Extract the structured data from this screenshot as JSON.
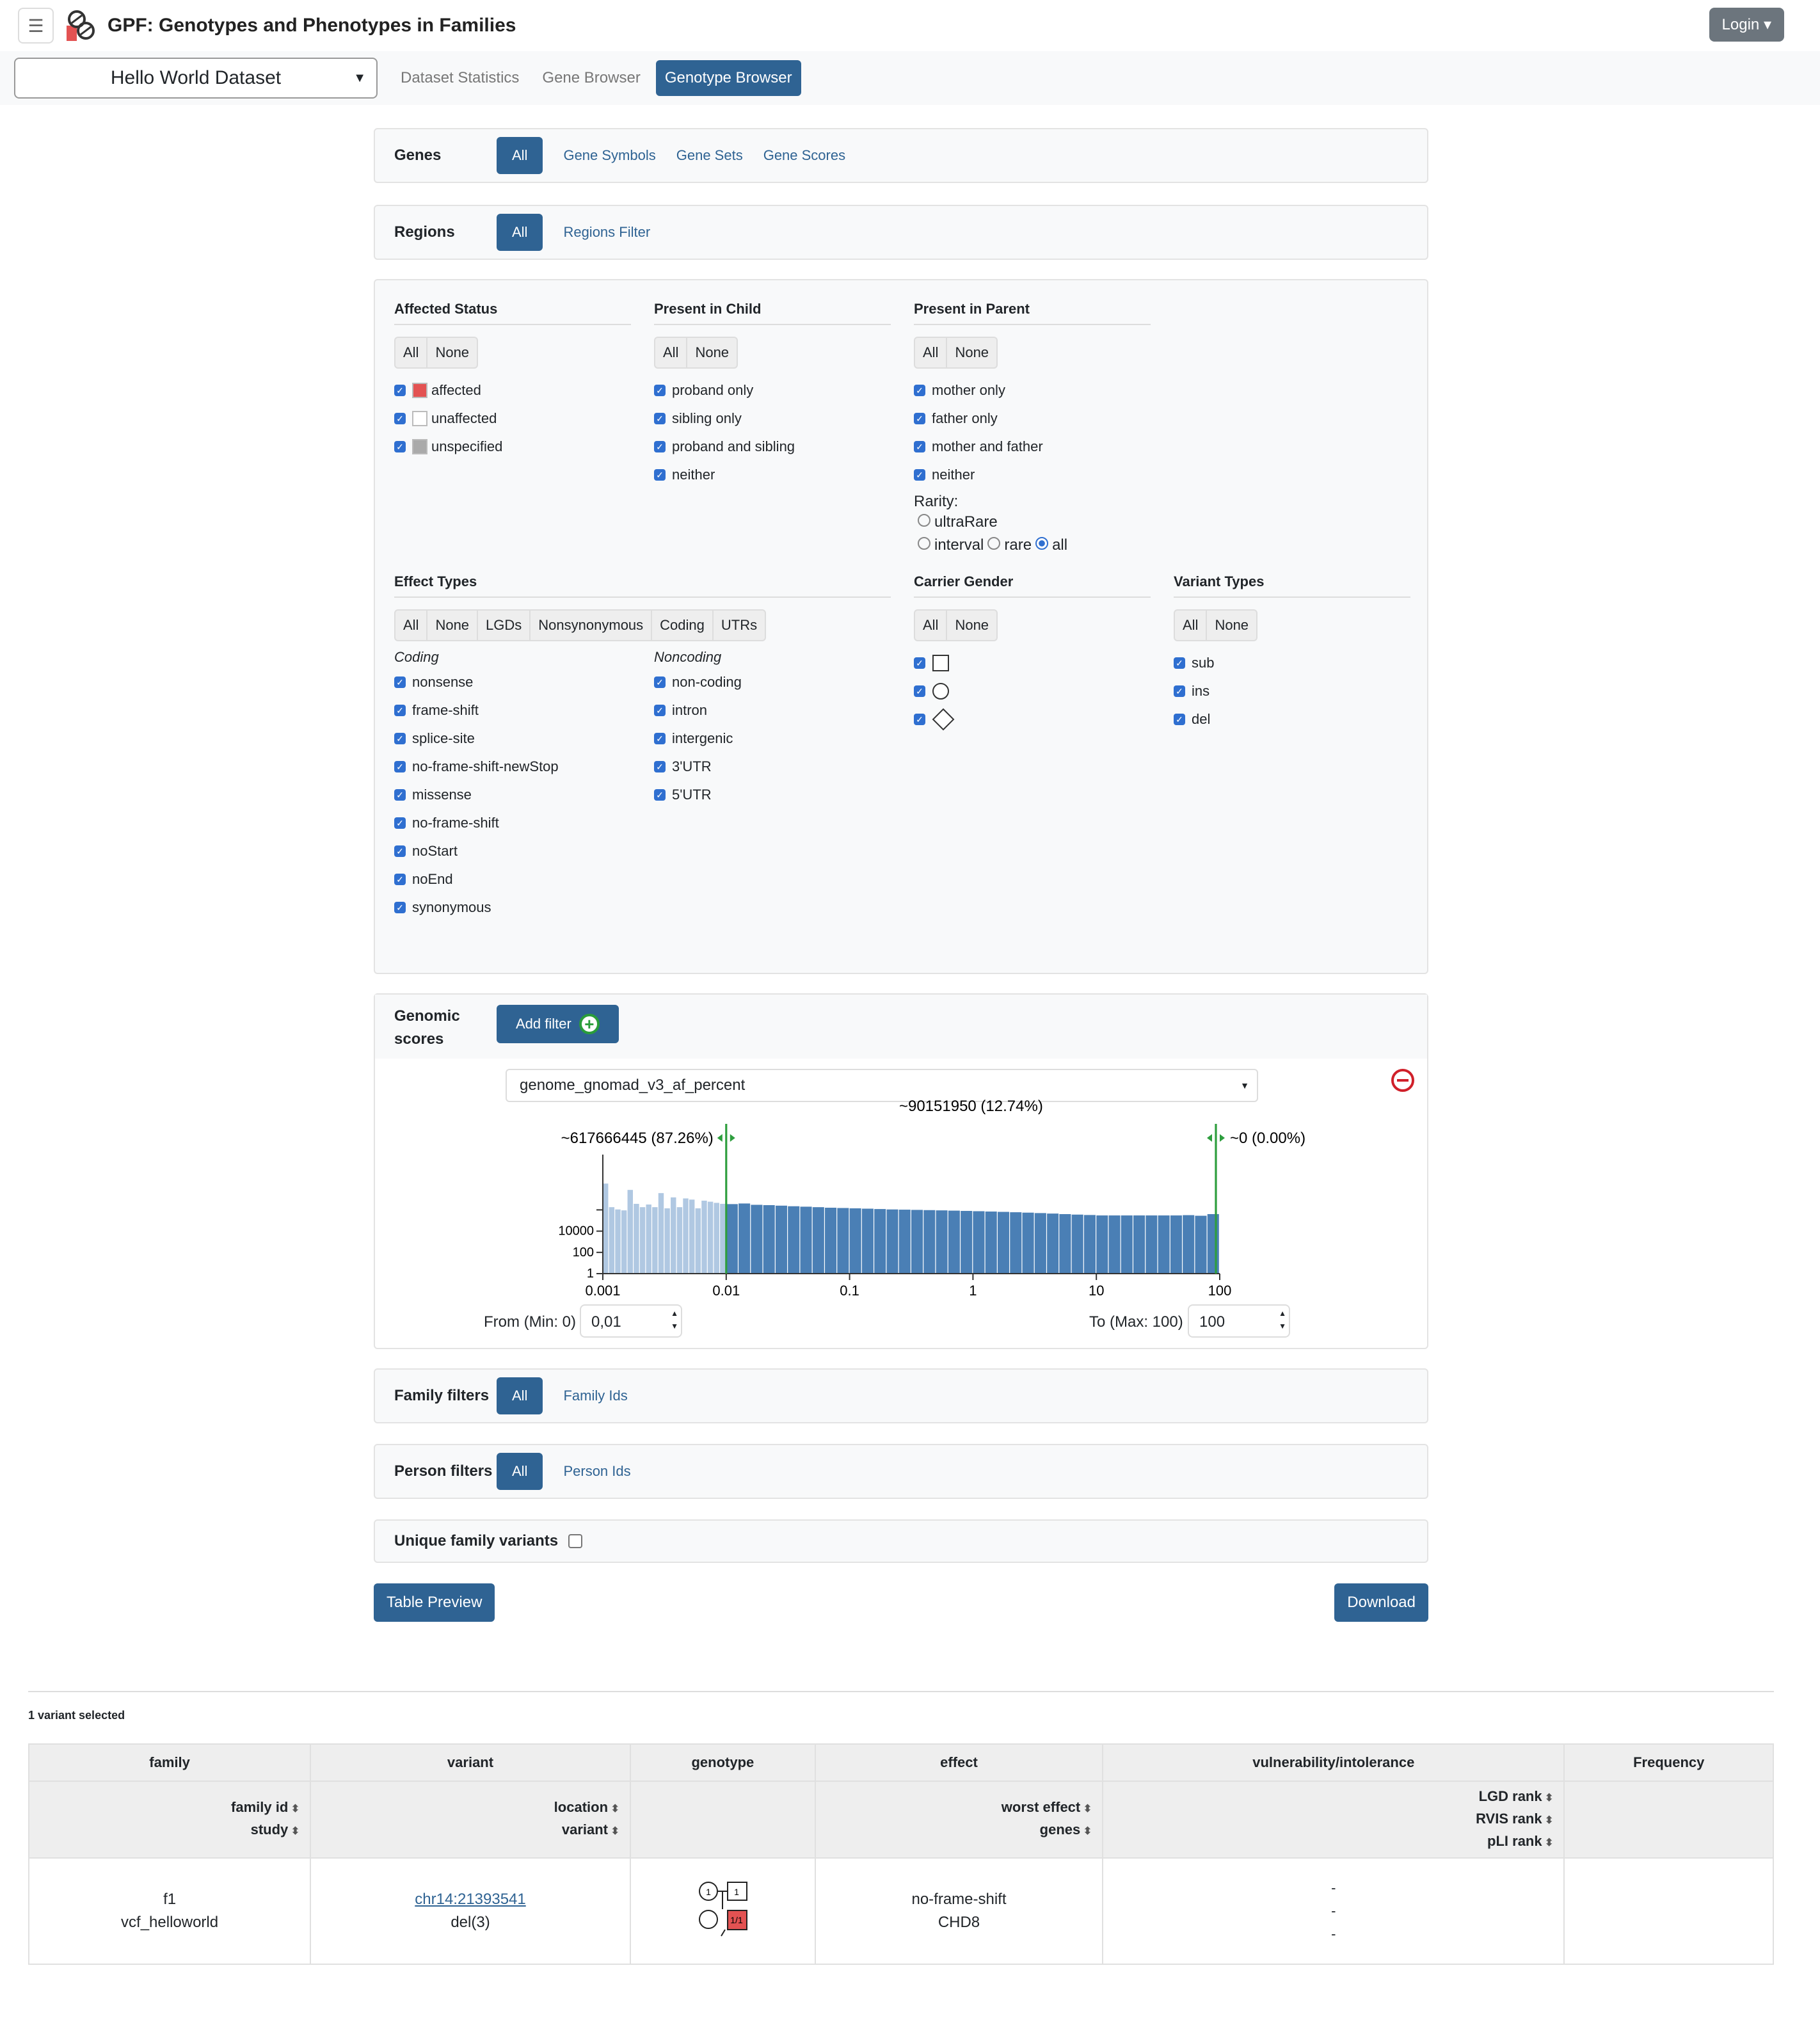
{
  "header": {
    "title": "GPF: Genotypes and Phenotypes in Families",
    "login": "Login",
    "menu_icon": "hamburger-icon"
  },
  "nav": {
    "dataset": "Hello World Dataset",
    "links": [
      "Dataset Statistics",
      "Gene Browser"
    ],
    "active": "Genotype Browser"
  },
  "genes": {
    "label": "Genes",
    "active": "All",
    "tabs": [
      "Gene Symbols",
      "Gene Sets",
      "Gene Scores"
    ]
  },
  "regions": {
    "label": "Regions",
    "active": "All",
    "tabs": [
      "Regions Filter"
    ]
  },
  "affected": {
    "title": "Affected Status",
    "buttons": [
      "All",
      "None"
    ],
    "items": [
      {
        "label": "affected",
        "color": "#e35252"
      },
      {
        "label": "unaffected",
        "color": "#ffffff"
      },
      {
        "label": "unspecified",
        "color": "#aaaaaa"
      }
    ]
  },
  "child": {
    "title": "Present in Child",
    "buttons": [
      "All",
      "None"
    ],
    "items": [
      "proband only",
      "sibling only",
      "proband and sibling",
      "neither"
    ]
  },
  "parent": {
    "title": "Present in Parent",
    "buttons": [
      "All",
      "None"
    ],
    "items": [
      "mother only",
      "father only",
      "mother and father",
      "neither"
    ],
    "rarity_label": "Rarity:",
    "rarity": [
      "ultraRare",
      "interval",
      "rare",
      "all"
    ],
    "rarity_selected": "all"
  },
  "effects": {
    "title": "Effect Types",
    "buttons": [
      "All",
      "None",
      "LGDs",
      "Nonsynonymous",
      "Coding",
      "UTRs"
    ],
    "coding_label": "Coding",
    "coding": [
      "nonsense",
      "frame-shift",
      "splice-site",
      "no-frame-shift-newStop",
      "missense",
      "no-frame-shift",
      "noStart",
      "noEnd",
      "synonymous"
    ],
    "noncoding_label": "Noncoding",
    "noncoding": [
      "non-coding",
      "intron",
      "intergenic",
      "3'UTR",
      "5'UTR"
    ]
  },
  "gender": {
    "title": "Carrier Gender",
    "buttons": [
      "All",
      "None"
    ],
    "items": [
      "male-square-icon",
      "female-circle-icon",
      "unspecified-diamond-icon"
    ]
  },
  "vtypes": {
    "title": "Variant Types",
    "buttons": [
      "All",
      "None"
    ],
    "items": [
      "sub",
      "ins",
      "del"
    ]
  },
  "scores": {
    "label1": "Genomic",
    "label2": "scores",
    "add": "Add filter",
    "selected": "genome_gnomad_v3_af_percent",
    "from_label": "From (Min: 0)",
    "from": "0,01",
    "to_label": "To (Max: 100)",
    "to": "100"
  },
  "chart_data": {
    "type": "bar",
    "xscale": "log",
    "yscale": "log",
    "xlim": [
      0.001,
      100
    ],
    "xticks": [
      "0.001",
      "0.01",
      "0.1",
      "1",
      "10",
      "100"
    ],
    "yticks": [
      "1",
      "100",
      "10000"
    ],
    "selected_range": [
      0.01,
      100
    ],
    "labels": {
      "left": "~617666445 (87.26%)",
      "middle": "~90151950 (12.74%)",
      "right": "~0 (0.00%)"
    },
    "values": [
      300000000.0,
      1800000.0,
      1100000.0,
      900000.0,
      76000000.0,
      3700000.0,
      1800000.0,
      3200000.0,
      1800000.0,
      38000000.0,
      1400000.0,
      15000000.0,
      1800000.0,
      12000000.0,
      9300000.0,
      1400000.0,
      7400000.0,
      5900000.0,
      4600000.0,
      3700000.0,
      3500000.0,
      4000000.0,
      3000000.0,
      2800000.0,
      2500000.0,
      2200000.0,
      2000000.0,
      1800000.0,
      1600000.0,
      1500000.0,
      1400000.0,
      1300000.0,
      1200000.0,
      1100000.0,
      1050000.0,
      1000000.0,
      950000.0,
      900000.0,
      850000.0,
      800000.0,
      750000.0,
      700000.0,
      650000.0,
      600000.0,
      550000.0,
      500000.0,
      450000.0,
      400000.0,
      360000.0,
      330000.0,
      300000.0,
      300000.0,
      300000.0,
      300000.0,
      300000.0,
      300000.0,
      300000.0,
      320000.0,
      280000.0,
      400000.0
    ],
    "colors": {
      "selected": "#4a7fb5",
      "unselected": "#b0c8e2",
      "marker": "#2e9e3e"
    }
  },
  "family": {
    "label": "Family filters",
    "active": "All",
    "tabs": [
      "Family Ids"
    ]
  },
  "person": {
    "label": "Person filters",
    "active": "All",
    "tabs": [
      "Person Ids"
    ]
  },
  "unique": "Unique family variants",
  "preview": "Table Preview",
  "download": "Download",
  "selected_count": "1 variant selected",
  "table": {
    "groups": [
      "family",
      "variant",
      "genotype",
      "effect",
      "vulnerability/intolerance",
      "Frequency"
    ],
    "sub": [
      [
        "family id",
        "study"
      ],
      [
        "location",
        "variant"
      ],
      [],
      [
        "worst effect",
        "genes"
      ],
      [
        "LGD rank",
        "RVIS rank",
        "pLI rank"
      ],
      []
    ],
    "row": {
      "family_id": "f1",
      "study": "vcf_helloworld",
      "location": "chr14:21393541",
      "variant": "del(3)",
      "pedigree_father": "1",
      "pedigree_child": "1/1",
      "worst_effect": "no-frame-shift",
      "genes": "CHD8",
      "lgd": "-",
      "rvis": "-",
      "pli": "-"
    }
  }
}
